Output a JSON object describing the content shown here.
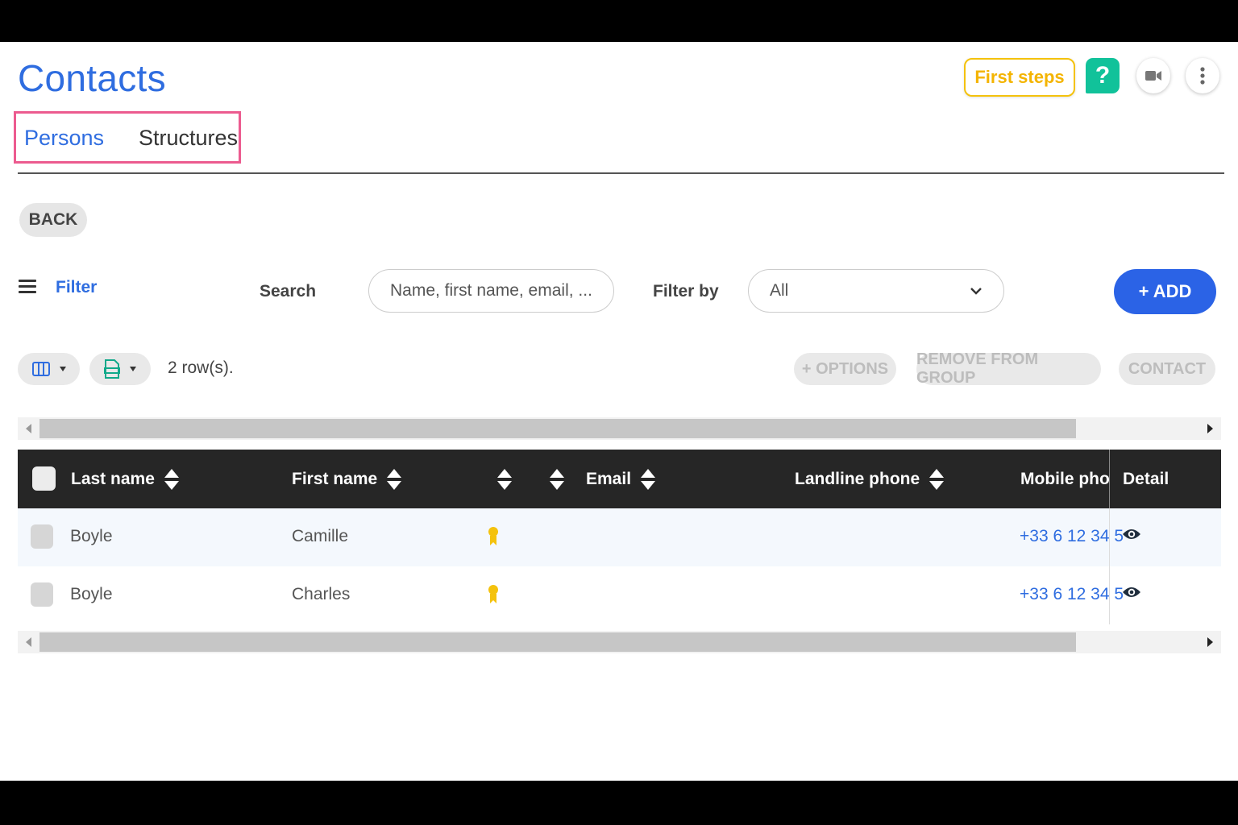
{
  "page": {
    "title": "Contacts"
  },
  "header": {
    "first_steps_label": "First steps",
    "help_label": "?"
  },
  "tabs": [
    {
      "label": "Persons",
      "active": true
    },
    {
      "label": "Structures",
      "active": false
    }
  ],
  "back_label": "BACK",
  "filter_bar": {
    "filter_label": "Filter",
    "search_label": "Search",
    "search_placeholder": "Name, first name, email, ...",
    "filter_by_label": "Filter by",
    "filter_by_value": "All",
    "add_label": "+ ADD"
  },
  "toolbar": {
    "rows_count": "2 row(s).",
    "options_label": "+ OPTIONS",
    "remove_from_group_label": "REMOVE FROM GROUP",
    "contact_label": "CONTACT"
  },
  "table": {
    "columns": [
      "Last name",
      "First name",
      "",
      "",
      "Email",
      "Landline phone",
      "Mobile phone",
      "Detail"
    ],
    "rows": [
      {
        "last_name": "Boyle",
        "first_name": "Camille",
        "mobile": "+33 6 12 34 5"
      },
      {
        "last_name": "Boyle",
        "first_name": "Charles",
        "mobile": "+33 6 12 34 5"
      }
    ]
  },
  "colors": {
    "accent": "#2f6de0",
    "add_button": "#2b63e6",
    "help": "#11c29a",
    "first_steps": "#f4b400",
    "tabs_highlight": "#ec5b8f"
  },
  "icons": [
    "video-camera-icon",
    "more-vertical-icon",
    "menu-icon",
    "columns-icon",
    "export-file-icon",
    "award-badge-icon",
    "eye-icon",
    "sort-icon"
  ]
}
